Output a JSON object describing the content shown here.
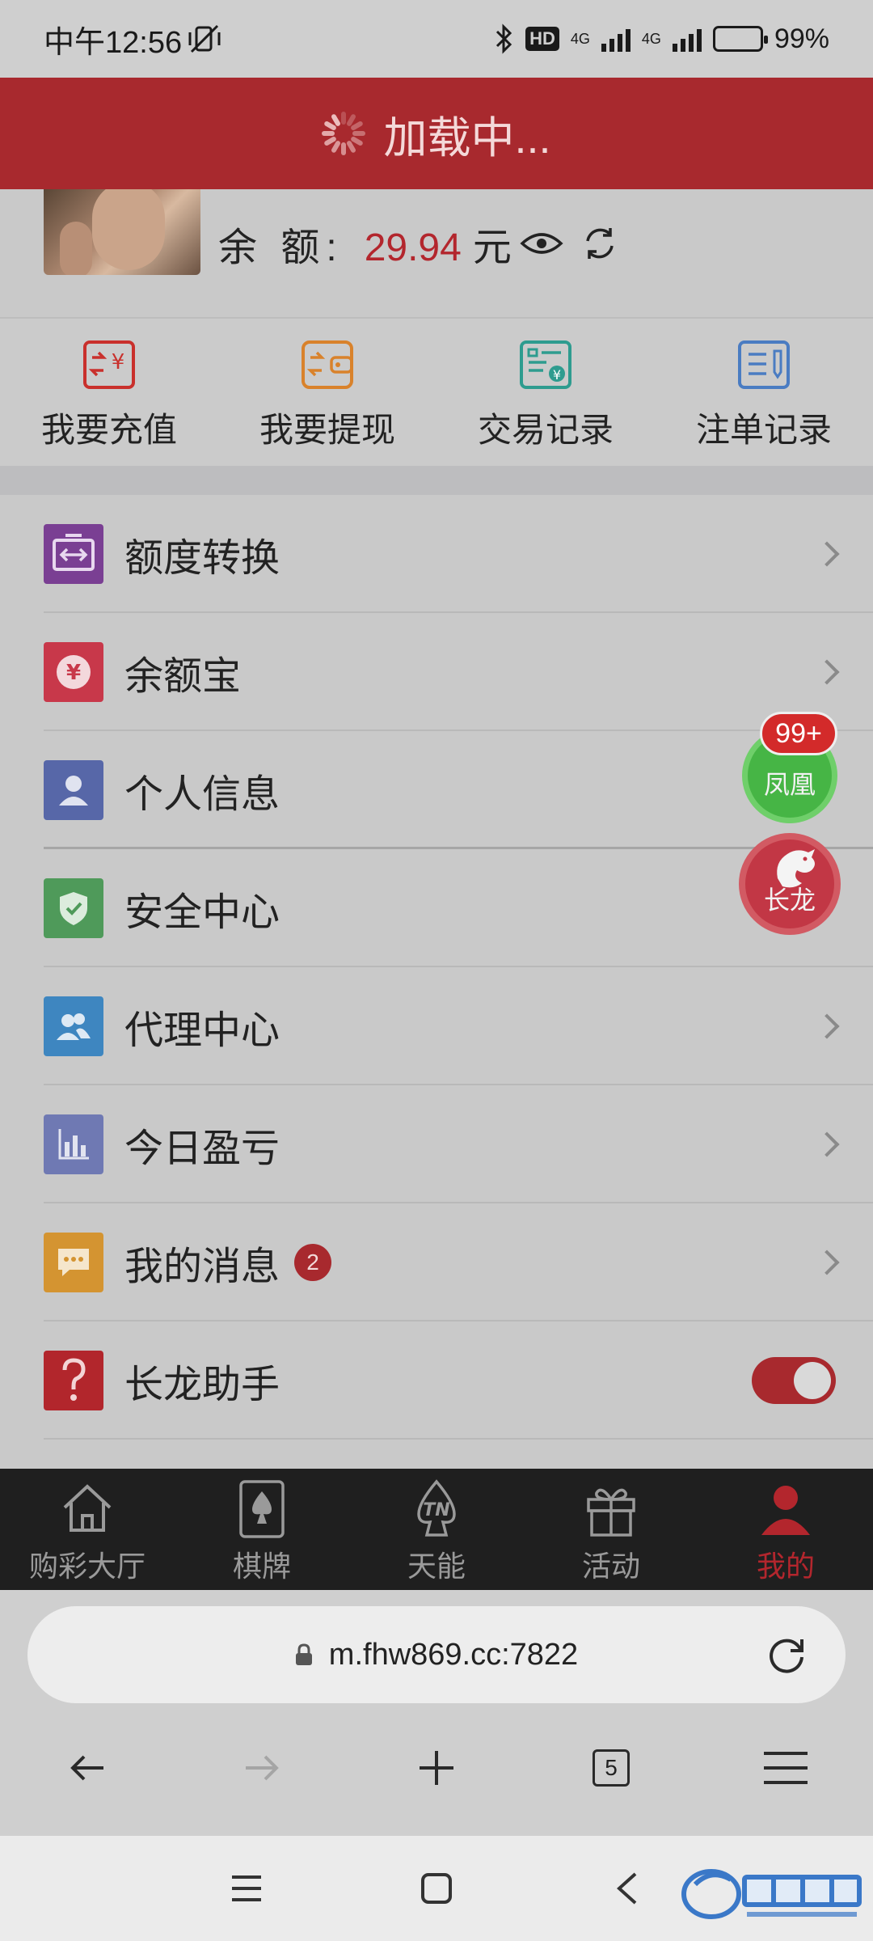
{
  "status_bar": {
    "time": "中午12:56",
    "network_1": "4G",
    "network_2": "4G",
    "hd_label": "HD",
    "battery": "99%"
  },
  "loading": {
    "text": "加载中..."
  },
  "profile": {
    "balance_label": "余 额:",
    "balance_value": "29.94",
    "balance_unit": "元"
  },
  "quick_actions": [
    {
      "label": "我要充值",
      "icon": "recharge-icon",
      "color": "#c9302c"
    },
    {
      "label": "我要提现",
      "icon": "withdraw-wallet-icon",
      "color": "#d9822b"
    },
    {
      "label": "交易记录",
      "icon": "transaction-record-icon",
      "color": "#2e9c8f"
    },
    {
      "label": "注单记录",
      "icon": "bet-record-icon",
      "color": "#4a7cc2"
    }
  ],
  "menu": [
    {
      "label": "额度转换",
      "icon": "transfer-icon",
      "color": "#7a3f93"
    },
    {
      "label": "余额宝",
      "icon": "yuan-coin-icon",
      "color": "#c8384a"
    },
    {
      "label": "个人信息",
      "icon": "user-icon",
      "color": "#5767a8"
    },
    {
      "label": "安全中心",
      "icon": "shield-icon",
      "color": "#4f9a5a"
    },
    {
      "label": "代理中心",
      "icon": "agents-icon",
      "color": "#3e86c0"
    },
    {
      "label": "今日盈亏",
      "icon": "bar-chart-icon",
      "color": "#6f79b3"
    },
    {
      "label": "我的消息",
      "icon": "message-icon",
      "color": "#d49431",
      "badge": "2"
    },
    {
      "label": "长龙助手",
      "icon": "question-icon",
      "color": "#b2262c",
      "toggle": true
    }
  ],
  "floating": {
    "fenghuang_label": "凤凰",
    "fenghuang_badge": "99+",
    "changlong_label": "长龙"
  },
  "bottom_nav": [
    {
      "label": "购彩大厅",
      "icon": "home-icon"
    },
    {
      "label": "棋牌",
      "icon": "poker-card-icon"
    },
    {
      "label": "天能",
      "icon": "tn-spade-icon"
    },
    {
      "label": "活动",
      "icon": "gift-icon"
    },
    {
      "label": "我的",
      "icon": "person-icon",
      "active": true
    }
  ],
  "browser": {
    "url": "m.fhw869.cc:7822",
    "tab_count": "5"
  }
}
